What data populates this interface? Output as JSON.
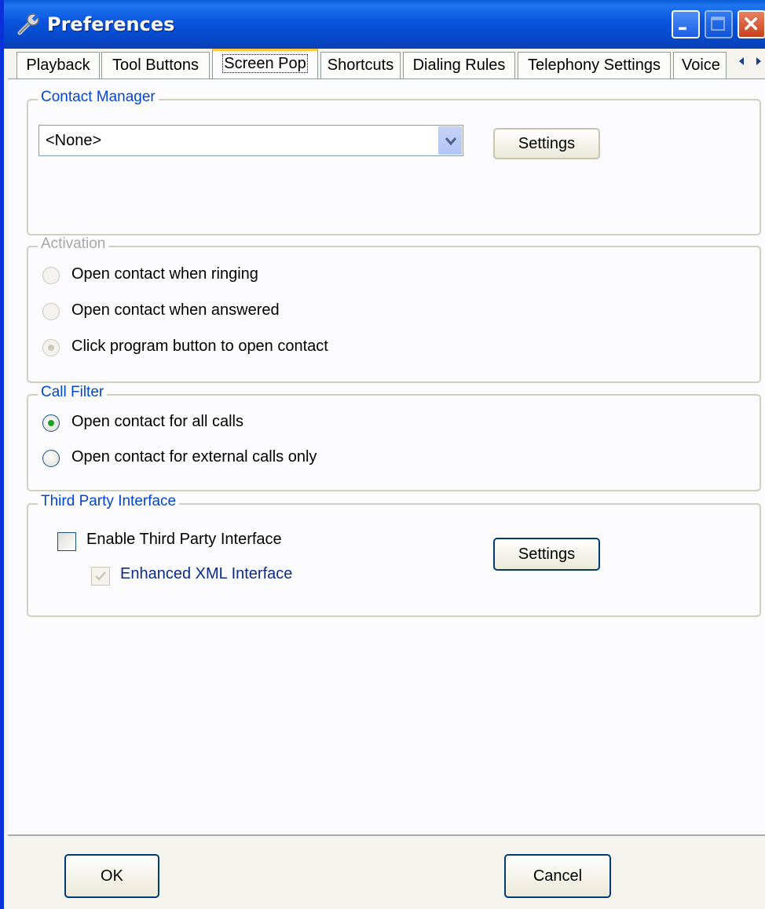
{
  "window": {
    "title": "Preferences"
  },
  "tabs": [
    {
      "label": "Playback"
    },
    {
      "label": "Tool Buttons"
    },
    {
      "label": "Screen Pop",
      "active": true
    },
    {
      "label": "Shortcuts"
    },
    {
      "label": "Dialing Rules"
    },
    {
      "label": "Telephony Settings"
    },
    {
      "label": "Voice"
    }
  ],
  "contact_manager": {
    "title": "Contact Manager",
    "selected": "<None>",
    "settings_label": "Settings"
  },
  "activation": {
    "title": "Activation",
    "options": [
      {
        "label": "Open contact when ringing",
        "selected": false
      },
      {
        "label": "Open contact when answered",
        "selected": false
      },
      {
        "label": "Click program button to open contact",
        "selected": true
      }
    ]
  },
  "call_filter": {
    "title": "Call Filter",
    "options": [
      {
        "label": "Open contact for all calls",
        "selected": true
      },
      {
        "label": "Open contact for external calls only",
        "selected": false
      }
    ]
  },
  "third_party": {
    "title": "Third Party Interface",
    "enable_label": "Enable Third Party Interface",
    "enable_checked": false,
    "xml_label": "Enhanced XML Interface",
    "xml_checked": true,
    "settings_label": "Settings"
  },
  "footer": {
    "ok_label": "OK",
    "cancel_label": "Cancel"
  },
  "colors": {
    "title_bar": "#0854dd",
    "group_title": "#0046d5",
    "disabled_text": "#a7a6aa",
    "active_tab_accent": "#ffc83c"
  }
}
